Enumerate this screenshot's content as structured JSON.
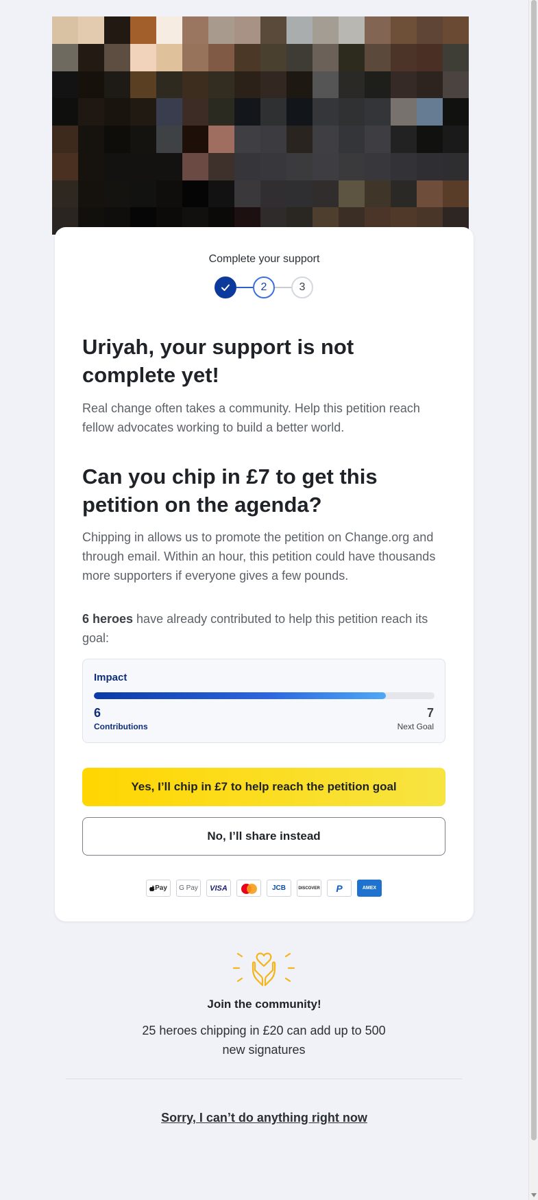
{
  "steps": {
    "title": "Complete your support",
    "items": [
      {
        "label": "",
        "state": "done"
      },
      {
        "label": "2",
        "state": "current"
      },
      {
        "label": "3",
        "state": "todo"
      }
    ]
  },
  "heading_primary": "Uriyah, your support is not complete yet!",
  "intro_text": "Real change often takes a community. Help this petition reach fellow advocates working to build a better world.",
  "heading_ask": "Can you chip in £7 to get this petition on the agenda?",
  "ask_text": "Chipping in allows us to promote the petition on Change.org and through email. Within an hour, this petition could have thousands more supporters if everyone gives a few pounds.",
  "heroes": {
    "count_label": "6 heroes",
    "rest": " have already contributed to help this petition reach its goal:"
  },
  "impact": {
    "title": "Impact",
    "progress_fraction": 0.857,
    "contributions_value": "6",
    "contributions_label": "Contributions",
    "next_goal_value": "7",
    "next_goal_label": "Next Goal",
    "colors": {
      "fill_start": "#0b3aa8",
      "fill_end": "#4ea8f5",
      "title": "#0d2d7a"
    }
  },
  "buttons": {
    "yes_label": "Yes, I’ll chip in £7 to help reach the petition goal",
    "no_label": "No, I’ll share instead"
  },
  "payment_methods": [
    "Pay",
    "G Pay",
    "VISA",
    "mastercard",
    "JCB",
    "DISCOVER",
    "P",
    "AMEX"
  ],
  "community": {
    "icon": "heart-hands-icon",
    "title": "Join the community!",
    "text": "25 heroes chipping in £20 can add up to 500 new signatures"
  },
  "decline_link": "Sorry, I can’t do anything right now",
  "accent_colors": {
    "primary_button": "#ffd600",
    "brand_blue": "#0c3a9c"
  }
}
